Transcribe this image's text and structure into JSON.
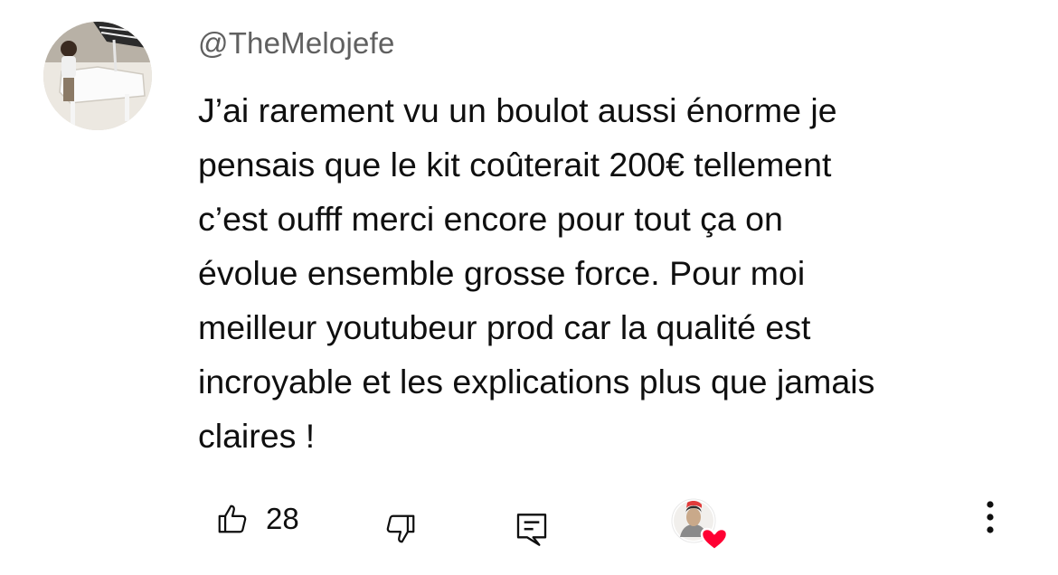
{
  "comment": {
    "author_handle": "@TheMelojefe",
    "avatar_icon": "piano-player-avatar",
    "text_lines": [
      "J’ai rarement vu un boulot aussi énorme je",
      "pensais que le kit coûterait 200€ tellement",
      "c’est oufff merci encore pour tout ça on",
      "évolue ensemble grosse force. Pour moi",
      "meilleur youtubeur prod car la qualité est",
      "incroyable et les explications plus que jamais",
      "claires !"
    ]
  },
  "actions": {
    "like_icon": "thumbs-up-icon",
    "like_count": "28",
    "dislike_icon": "thumbs-down-icon",
    "reply_icon": "reply-comment-icon",
    "creator_heart_icon": "creator-heart-icon",
    "more_icon": "more-vertical-icon"
  },
  "colors": {
    "heart": "#ff0033",
    "handle": "#606060",
    "text": "#0f0f0f"
  }
}
